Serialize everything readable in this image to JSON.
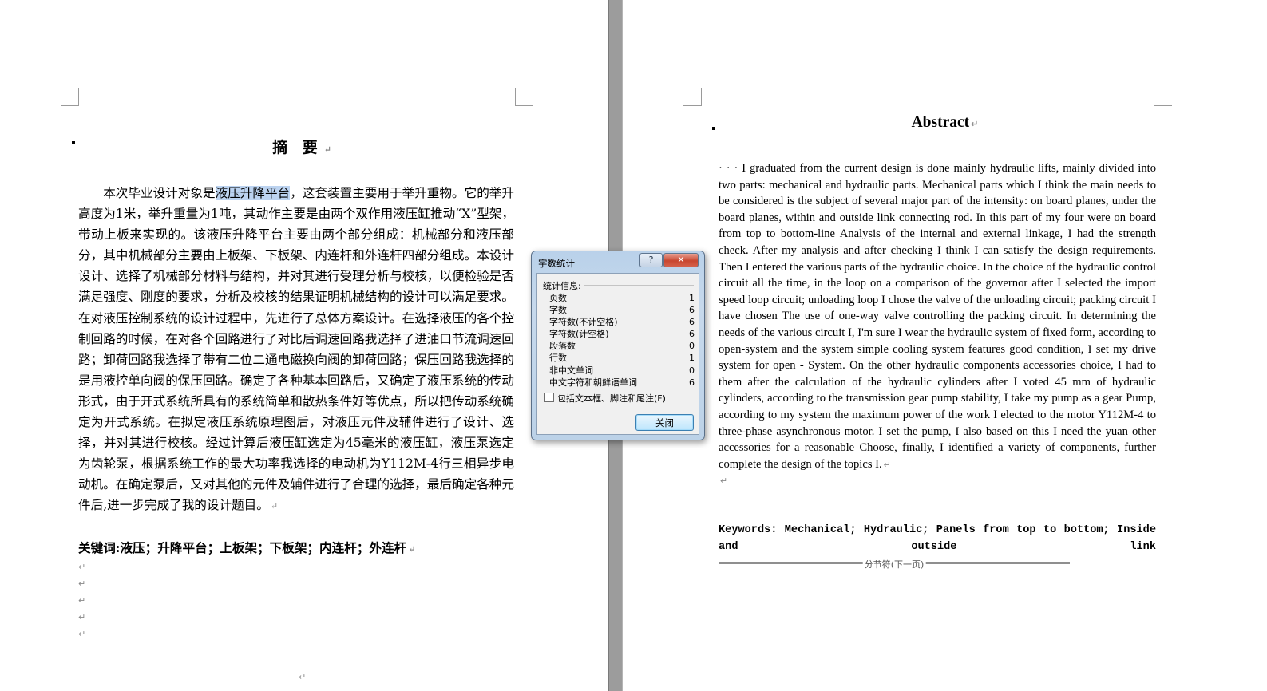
{
  "left_page": {
    "title": "摘 要",
    "body_pre": "本次毕业设计对象是",
    "body_highlight": "液压升降平台",
    "body_post": "，这套装置主要用于举升重物。它的举升高度为1米，举升重量为1吨，其动作主要是由两个双作用液压缸推动“X”型架，带动上板来实现的。该液压升降平台主要由两个部分组成：机械部分和液压部分，其中机械部分主要由上板架、下板架、内连杆和外连杆四部分组成。本设计设计、选择了机械部分材料与结构，并对其进行受理分析与校核，以便检验是否满足强度、刚度的要求，分析及校核的结果证明机械结构的设计可以满足要求。在对液压控制系统的设计过程中，先进行了总体方案设计。在选择液压的各个控制回路的时候，在对各个回路进行了对比后调速回路我选择了进油口节流调速回路；卸荷回路我选择了带有二位二通电磁换向阀的卸荷回路；保压回路我选择的是用液控单向阀的保压回路。确定了各种基本回路后，又确定了液压系统的传动形式，由于开式系统所具有的系统简单和散热条件好等优点，所以把传动系统确定为开式系统。在拟定液压系统原理图后，对液压元件及辅件进行了设计、选择，并对其进行校核。经过计算后液压缸选定为45毫米的液压缸，液压泵选定为齿轮泵，根据系统工作的最大功率我选择的电动机为Y112M-4行三相异步电动机。在确定泵后，又对其他的元件及辅件进行了合理的选择，最后确定各种元件后,进一步完成了我的设计题目。",
    "keywords": "关键词:液压；升降平台；上板架；下板架；内连杆；外连杆"
  },
  "right_page": {
    "title": "Abstract",
    "body": "· · · I graduated from the current design is done mainly hydraulic lifts, mainly divided into two parts: mechanical and hydraulic parts. Mechanical parts which I think the main needs to be considered is the subject of several major part of the intensity: on board planes, under the board planes, within and outside link connecting rod. In this part of my four were on board from top to bottom-line Analysis of the internal and external linkage, I had the strength check. After my analysis and after checking I think I can satisfy the design requirements. Then I entered the various parts of the hydraulic choice. In the choice of the hydraulic control circuit all the time, in the loop on a comparison of the governor after I selected the import speed loop circuit; unloading loop I chose the valve of the unloading circuit; packing circuit I have chosen The use of one-way valve controlling the packing circuit. In determining the needs of the various circuit I, I'm sure I wear the hydraulic system of fixed form, according to open-system and the system simple cooling system features good condition, I set my drive system for open - System. On the other hydraulic components accessories choice, I had to them after the calculation of the hydraulic cylinders after I voted 45 mm of hydraulic cylinders, according to the transmission gear pump stability, I take my pump as a gear Pump, according to my system the maximum power of the work I elected to the motor Y112M-4 to three-phase asynchronous motor. I set the pump, I also based on this I need the yuan other accessories for a reasonable Choose, finally, I identified a variety of components, further complete the design of the topics I.",
    "keywords": "Keywords: Mechanical; Hydraulic; Panels from top to bottom; Inside and outside link",
    "section_break": "分节符(下一页)"
  },
  "word_count_dialog": {
    "title": "字数统计",
    "help_label": "?",
    "close_x": "✕",
    "group_label": "统计信息:",
    "stats": [
      {
        "label": "页数",
        "value": "1"
      },
      {
        "label": "字数",
        "value": "6"
      },
      {
        "label": "字符数(不计空格)",
        "value": "6"
      },
      {
        "label": "字符数(计空格)",
        "value": "6"
      },
      {
        "label": "段落数",
        "value": "0"
      },
      {
        "label": "行数",
        "value": "1"
      },
      {
        "label": "非中文单词",
        "value": "0"
      },
      {
        "label": "中文字符和朝鲜语单词",
        "value": "6"
      }
    ],
    "checkbox_label": "包括文本框、脚注和尾注(F)",
    "close_button": "关闭"
  },
  "paragraph_mark": "↵"
}
